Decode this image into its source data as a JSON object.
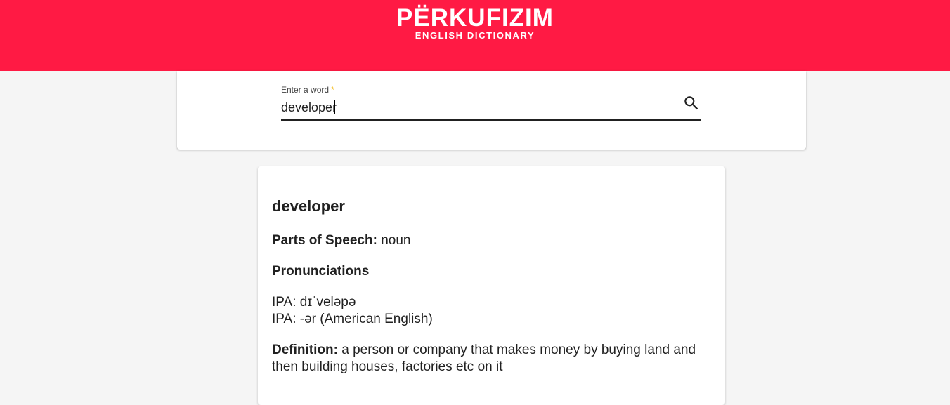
{
  "header": {
    "title": "PËRKUFIZIM",
    "subtitle": "ENGLISH DICTIONARY",
    "background_color": "#ff1a44"
  },
  "search": {
    "label": "Enter a word",
    "required_marker": "*",
    "value": "developer",
    "button_icon": "search-icon"
  },
  "result": {
    "word": "developer",
    "parts_of_speech_label": "Parts of Speech:",
    "parts_of_speech_value": "noun",
    "pronunciations_heading": "Pronunciations",
    "ipa_label": "IPA:",
    "pronunciations": [
      "dɪˈveləpə",
      "-ər (American English)"
    ],
    "definition_label": "Definition:",
    "definition_value": "a person or company that makes money by buying land and then building houses, factories etc on it"
  }
}
